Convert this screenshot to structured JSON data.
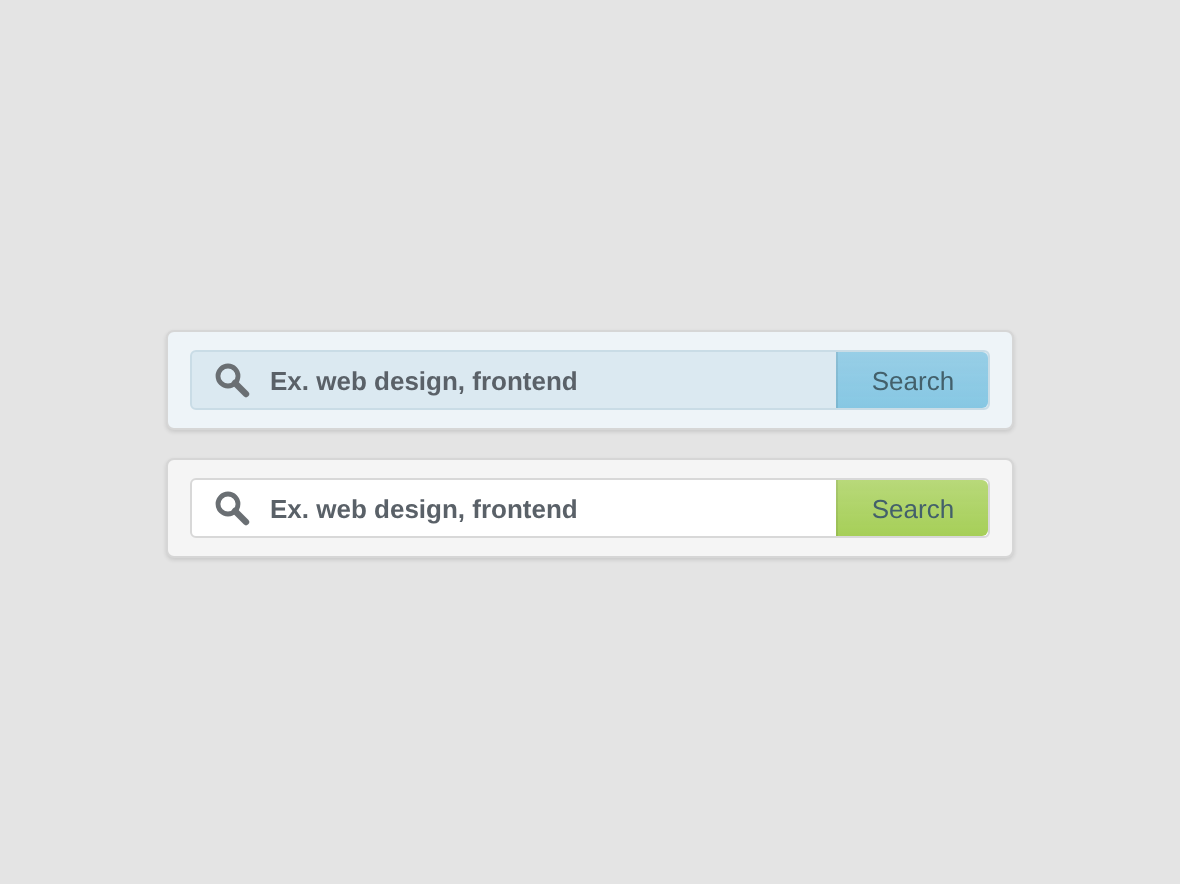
{
  "search_bars": [
    {
      "placeholder": "Ex. web design, frontend",
      "button": "Search",
      "focused": true,
      "color": "#86c7e3"
    },
    {
      "placeholder": "Ex. web design, frontend",
      "button": "Search",
      "focused": false,
      "color": "#a6cf58"
    }
  ]
}
